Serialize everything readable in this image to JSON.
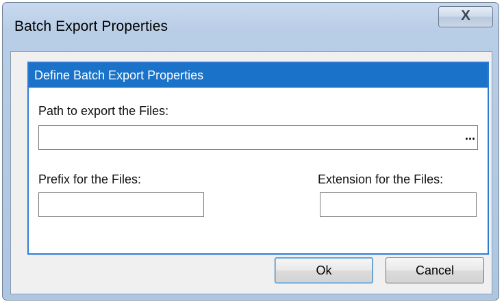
{
  "window": {
    "title": "Batch Export Properties",
    "close_glyph": "X"
  },
  "group": {
    "header": "Define Batch Export Properties",
    "path_label": "Path to export the Files:",
    "path_value": "",
    "browse_label": "...",
    "prefix_label": "Prefix for the Files:",
    "prefix_value": "",
    "extension_label": "Extension for the Files:",
    "extension_value": ""
  },
  "buttons": {
    "ok": "Ok",
    "cancel": "Cancel"
  },
  "colors": {
    "header_bg": "#1a73c9",
    "frame": "#b8cde6"
  }
}
